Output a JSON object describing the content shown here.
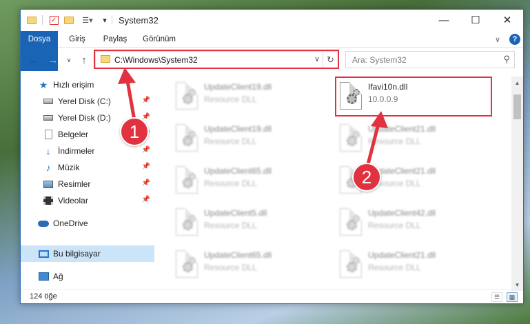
{
  "window": {
    "title": "System32"
  },
  "ribbon": {
    "tabs": [
      "Dosya",
      "Giriş",
      "Paylaş",
      "Görünüm"
    ]
  },
  "address": {
    "path": "C:\\Windows\\System32",
    "search_placeholder": "Ara: System32"
  },
  "sidebar": {
    "quick_access": "Hızlı erişim",
    "items": [
      {
        "label": "Yerel Disk (C:)",
        "icon": "drive-icon"
      },
      {
        "label": "Yerel Disk (D:)",
        "icon": "drive-icon"
      },
      {
        "label": "Belgeler",
        "icon": "documents-icon"
      },
      {
        "label": "İndirmeler",
        "icon": "downloads-icon"
      },
      {
        "label": "Müzik",
        "icon": "music-icon"
      },
      {
        "label": "Resimler",
        "icon": "pictures-icon"
      },
      {
        "label": "Videolar",
        "icon": "videos-icon"
      }
    ],
    "onedrive": "OneDrive",
    "this_pc": "Bu bilgisayar",
    "network": "Ağ"
  },
  "files": {
    "left": [
      {
        "name": "UpdateClient19.dll",
        "sub": "Resource DLL"
      },
      {
        "name": "UpdateClient19.dll",
        "sub": "Resource DLL"
      },
      {
        "name": "UpdateClient65.dll",
        "sub": "Resource DLL"
      },
      {
        "name": "UpdateClient5.dll",
        "sub": "Resource DLL"
      },
      {
        "name": "UpdateClient65.dll",
        "sub": "Resource DLL"
      }
    ],
    "right": [
      {
        "name": "Ifavi10n.dll",
        "sub": "10.0.0.9"
      },
      {
        "name": "UpdateClient21.dll",
        "sub": "Resource DLL"
      },
      {
        "name": "UpdateClient21.dll",
        "sub": "Resource DLL"
      },
      {
        "name": "UpdateClient42.dll",
        "sub": "Resource DLL"
      },
      {
        "name": "UpdateClient21.dll",
        "sub": "Resource DLL"
      }
    ]
  },
  "status": {
    "count": "124 öğe"
  },
  "callouts": {
    "one": "1",
    "two": "2"
  },
  "colors": {
    "accent": "#1a64b5",
    "highlight": "#e0333f",
    "selection": "#cce4f7"
  }
}
